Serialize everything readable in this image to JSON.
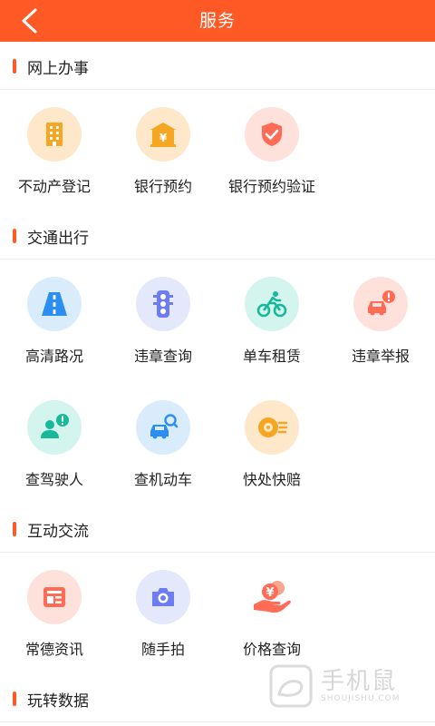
{
  "header": {
    "title": "服务"
  },
  "sections": [
    {
      "title": "网上办事"
    },
    {
      "title": "交通出行"
    },
    {
      "title": "互动交流"
    },
    {
      "title": "玩转数据"
    }
  ],
  "items": {
    "budongchan": {
      "label": "不动产登记",
      "icon": "building-icon",
      "color": "#ffe7c9"
    },
    "bank_booking": {
      "label": "银行预约",
      "icon": "bank-icon",
      "color": "#ffe7c9"
    },
    "bank_verify": {
      "label": "银行预约验证",
      "icon": "shield-check-icon",
      "color": "#ffe1dc"
    },
    "traffic_status": {
      "label": "高清路况",
      "icon": "road-icon",
      "color": "#d9ecfb"
    },
    "violation_query": {
      "label": "违章查询",
      "icon": "traffic-light-icon",
      "color": "#e4e8fb"
    },
    "bike_rental": {
      "label": "单车租赁",
      "icon": "cyclist-icon",
      "color": "#d4f4ee"
    },
    "violation_report": {
      "label": "违章举报",
      "icon": "car-alert-icon",
      "color": "#ffe1dc"
    },
    "driver_check": {
      "label": "查驾驶人",
      "icon": "person-alert-icon",
      "color": "#d4f4ee"
    },
    "vehicle_check": {
      "label": "查机动车",
      "icon": "car-search-icon",
      "color": "#d9ecfb"
    },
    "quick_claim": {
      "label": "快处快赔",
      "icon": "speed-wheel-icon",
      "color": "#ffe7c9"
    },
    "news": {
      "label": "常德资讯",
      "icon": "newspaper-icon",
      "color": "#ffe1dc"
    },
    "snapshot": {
      "label": "随手拍",
      "icon": "camera-icon",
      "color": "#e4e8fb"
    },
    "price_query": {
      "label": "价格查询",
      "icon": "hand-coins-icon",
      "color": "#ffffff"
    }
  },
  "watermark": {
    "brand": "手机鼠",
    "domain": "SHOUJISHU.COM"
  }
}
